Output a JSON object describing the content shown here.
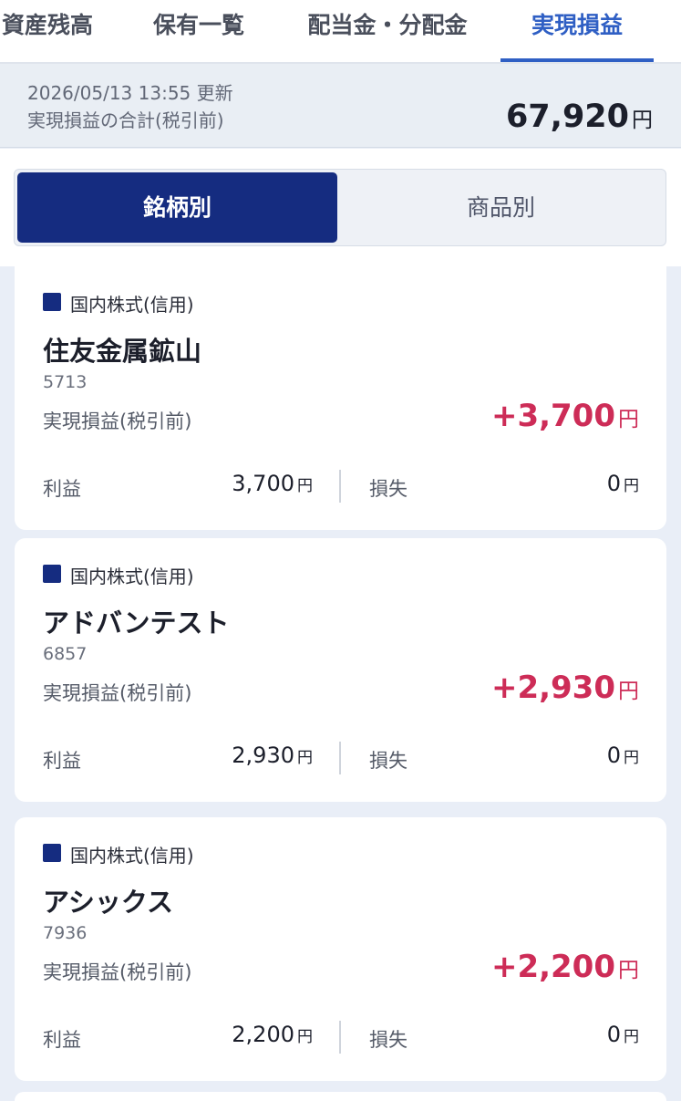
{
  "tabs": [
    {
      "label": "資産残高",
      "active": false
    },
    {
      "label": "保有一覧",
      "active": false
    },
    {
      "label": "配当金・分配金",
      "active": false
    },
    {
      "label": "実現損益",
      "active": true
    }
  ],
  "summary": {
    "updated": "2026/05/13 13:55 更新",
    "label": "実現損益の合計(税引前)",
    "total": "67,920",
    "unit": "円"
  },
  "view_toggle": {
    "by_stock": "銘柄別",
    "by_product": "商品別",
    "selected": "銘柄別"
  },
  "labels": {
    "pl_label": "実現損益(税引前)",
    "gain_label": "利益",
    "loss_label": "損失",
    "yen": "円"
  },
  "colors": {
    "accent": "#2f5fc4",
    "navy": "#152c80",
    "positive": "#cd2c57"
  },
  "holdings": [
    {
      "category": "国内株式(信用)",
      "name": "住友金属鉱山",
      "code": "5713",
      "pl": "+3,700",
      "gain": "3,700",
      "loss": "0"
    },
    {
      "category": "国内株式(信用)",
      "name": "アドバンテスト",
      "code": "6857",
      "pl": "+2,930",
      "gain": "2,930",
      "loss": "0"
    },
    {
      "category": "国内株式(信用)",
      "name": "アシックス",
      "code": "7936",
      "pl": "+2,200",
      "gain": "2,200",
      "loss": "0"
    }
  ]
}
